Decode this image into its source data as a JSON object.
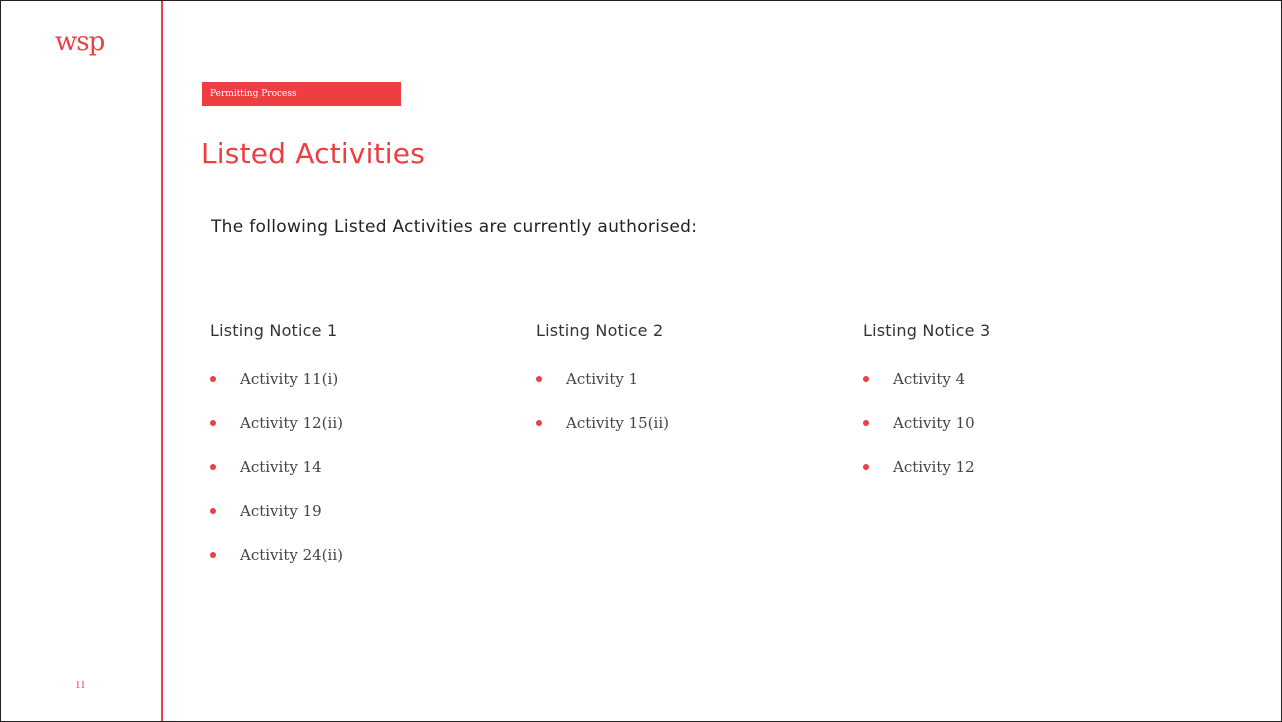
{
  "logo": {
    "text": "wsp"
  },
  "section_tag": "Permitting Process",
  "title": "Listed Activities",
  "intro": "The following Listed Activities are currently authorised:",
  "page_number": "11",
  "colors": {
    "accent": "#ef3e42",
    "border": "#222222",
    "text": "#333333"
  },
  "notices": [
    {
      "heading": "Listing Notice 1",
      "items": [
        "Activity 11(i)",
        "Activity 12(ii)",
        "Activity 14",
        "Activity 19",
        "Activity 24(ii)"
      ]
    },
    {
      "heading": "Listing Notice 2",
      "items": [
        "Activity 1",
        "Activity 15(ii)"
      ]
    },
    {
      "heading": "Listing Notice 3",
      "items": [
        "Activity 4",
        "Activity 10",
        "Activity 12"
      ]
    }
  ]
}
